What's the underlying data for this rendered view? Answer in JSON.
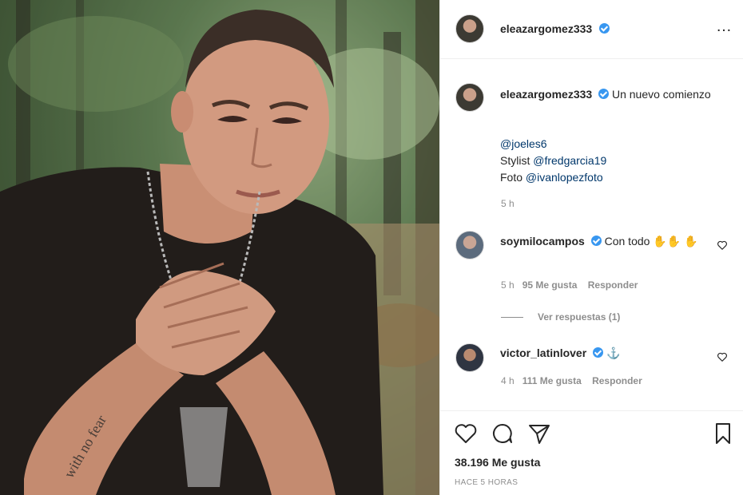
{
  "post": {
    "author": "eleazargomez333",
    "more_icon": "more-options-icon"
  },
  "caption": {
    "author": "eleazargomez333",
    "text": "Un nuevo comienzo",
    "mention1": "@joeles6",
    "stylist_label": "Stylist",
    "stylist_mention": "@fredgarcia19",
    "foto_label": "Foto",
    "foto_mention": "@ivanlopezfoto",
    "time": "5 h"
  },
  "comments": [
    {
      "author": "soymilocampos",
      "text": "Con todo ✋✋ ✋",
      "time": "5 h",
      "likes": "95 Me gusta",
      "reply": "Responder",
      "view_replies": "Ver respuestas (1)"
    },
    {
      "author": "victor_latinlover",
      "text": "⚓",
      "time": "4 h",
      "likes": "111 Me gusta",
      "reply": "Responder"
    }
  ],
  "footer": {
    "likes": "38.196 Me gusta",
    "time_ago": "HACE 5 HORAS"
  },
  "colors": {
    "verified": "#3897f0",
    "text": "#262626",
    "muted": "#8e8e8e",
    "mention": "#00376b"
  }
}
